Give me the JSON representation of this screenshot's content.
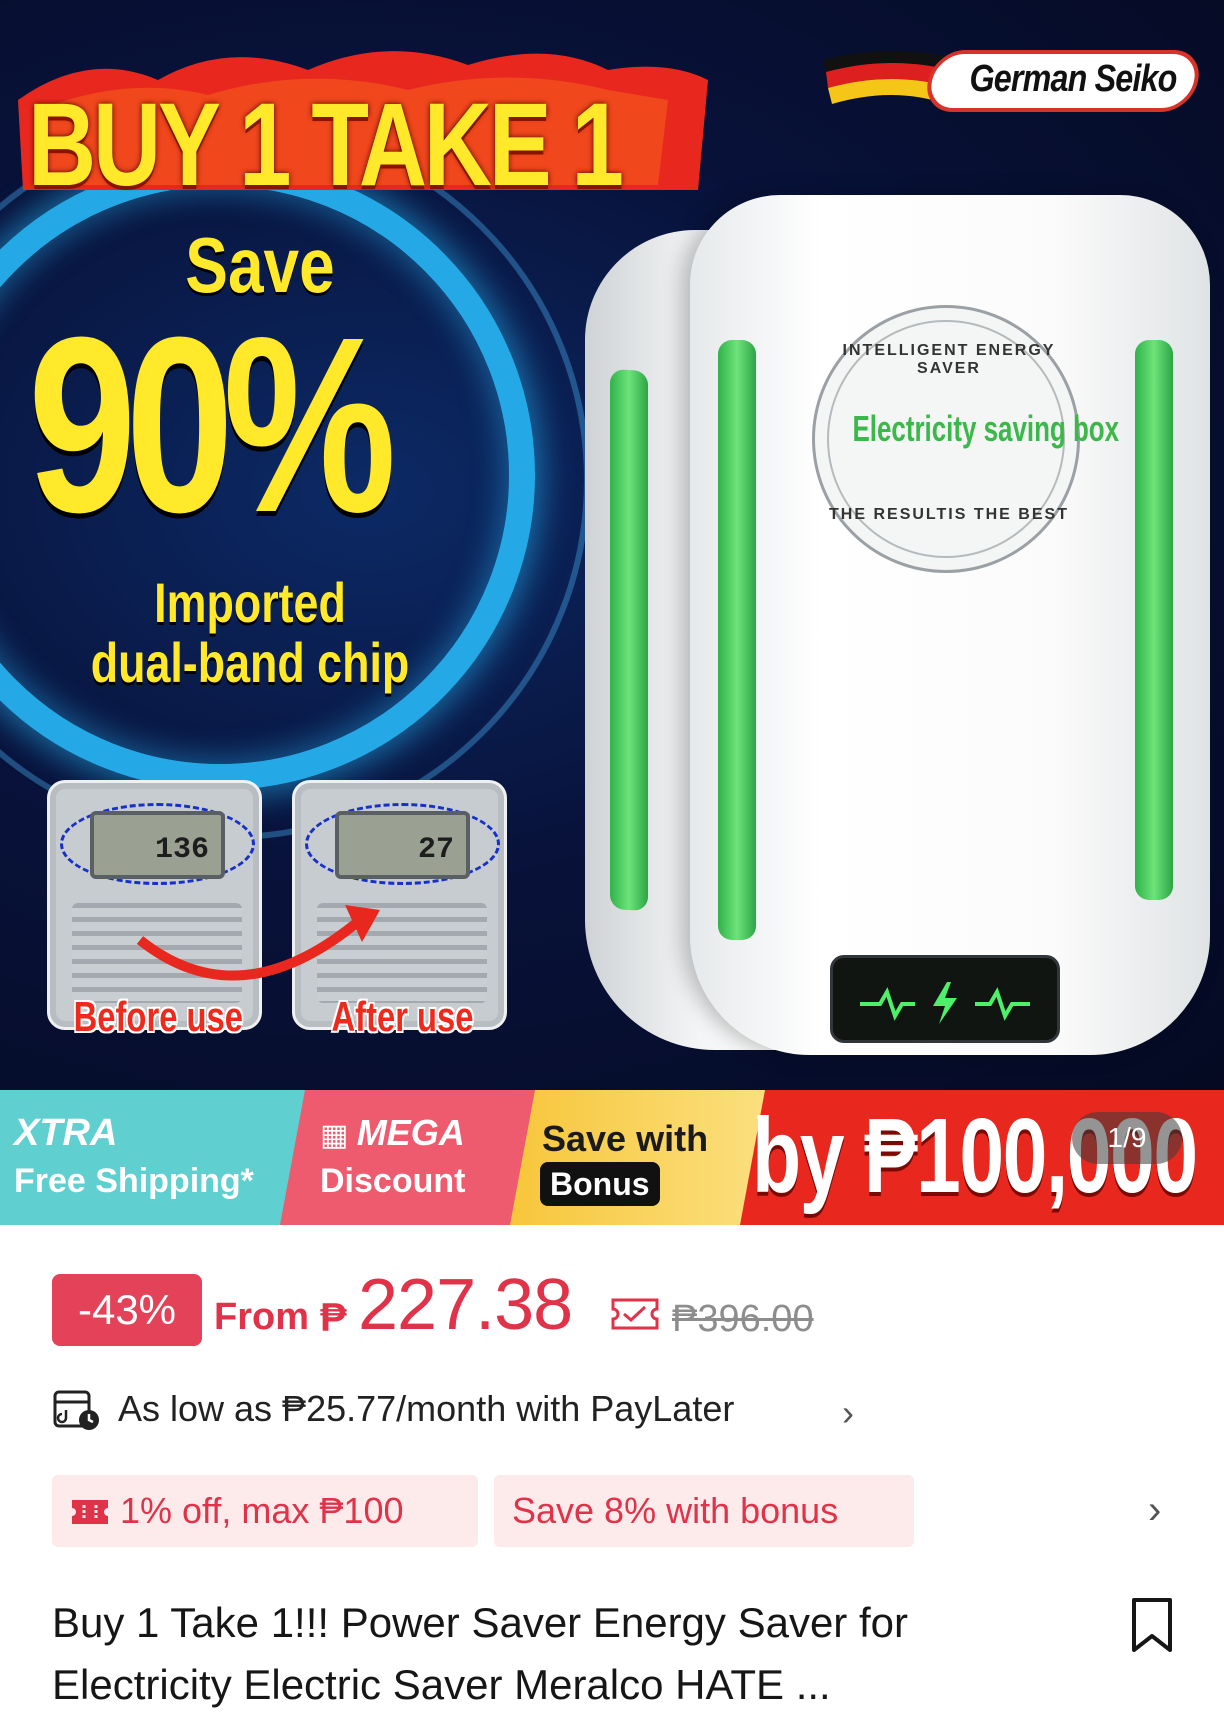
{
  "product_image": {
    "headline": "BUY 1 TAKE 1",
    "brand": "German Seiko",
    "save_label": "Save",
    "save_percent": "90%",
    "chip_line1": "Imported",
    "chip_line2": "dual-band chip",
    "meter_before_reading": "136",
    "meter_after_reading": "27",
    "before_label": "Before use",
    "after_label": "After use",
    "seal_top": "INTELLIGENT ENERGY SAVER",
    "seal_center": "Electricity saving box",
    "seal_bottom": "THE RESULTIS THE BEST",
    "image_counter": "1/9"
  },
  "promo_strip": {
    "xtra_title": "XTRA",
    "xtra_sub": "Free Shipping*",
    "mega_title": "MEGA",
    "mega_sub": "Discount",
    "bonus_title": "Save with",
    "bonus_chip": "Bonus",
    "big_text": "by ₱100,000"
  },
  "price": {
    "discount_badge": "-43%",
    "from_label": "From",
    "currency": "₱",
    "value": "227.38",
    "original": "₱396.00"
  },
  "paylater": {
    "text": "As low as ₱25.77/month with PayLater",
    "chevron": "›"
  },
  "tags": {
    "coupon": "1% off, max ₱100",
    "bonus": "Save 8% with bonus",
    "chevron": "›"
  },
  "title": "Buy 1 Take 1!!! Power Saver Energy Saver for Electricity Electric Saver Meralco HATE ...",
  "colors": {
    "price_red": "#e0334a",
    "badge_red": "#e44258",
    "tag_bg": "#fdeaea",
    "xtra_teal": "#5fcfd0",
    "mega_pink": "#ee5a6e",
    "bonus_yellow": "#f7c63a",
    "promo_red": "#e8281e",
    "headline_yellow": "#ffe92a"
  },
  "icons": {
    "voucher": "voucher-icon",
    "paylater": "paylater-icon",
    "coupon": "coupon-icon",
    "bookmark": "bookmark-icon",
    "flag": "german-flag-icon"
  }
}
